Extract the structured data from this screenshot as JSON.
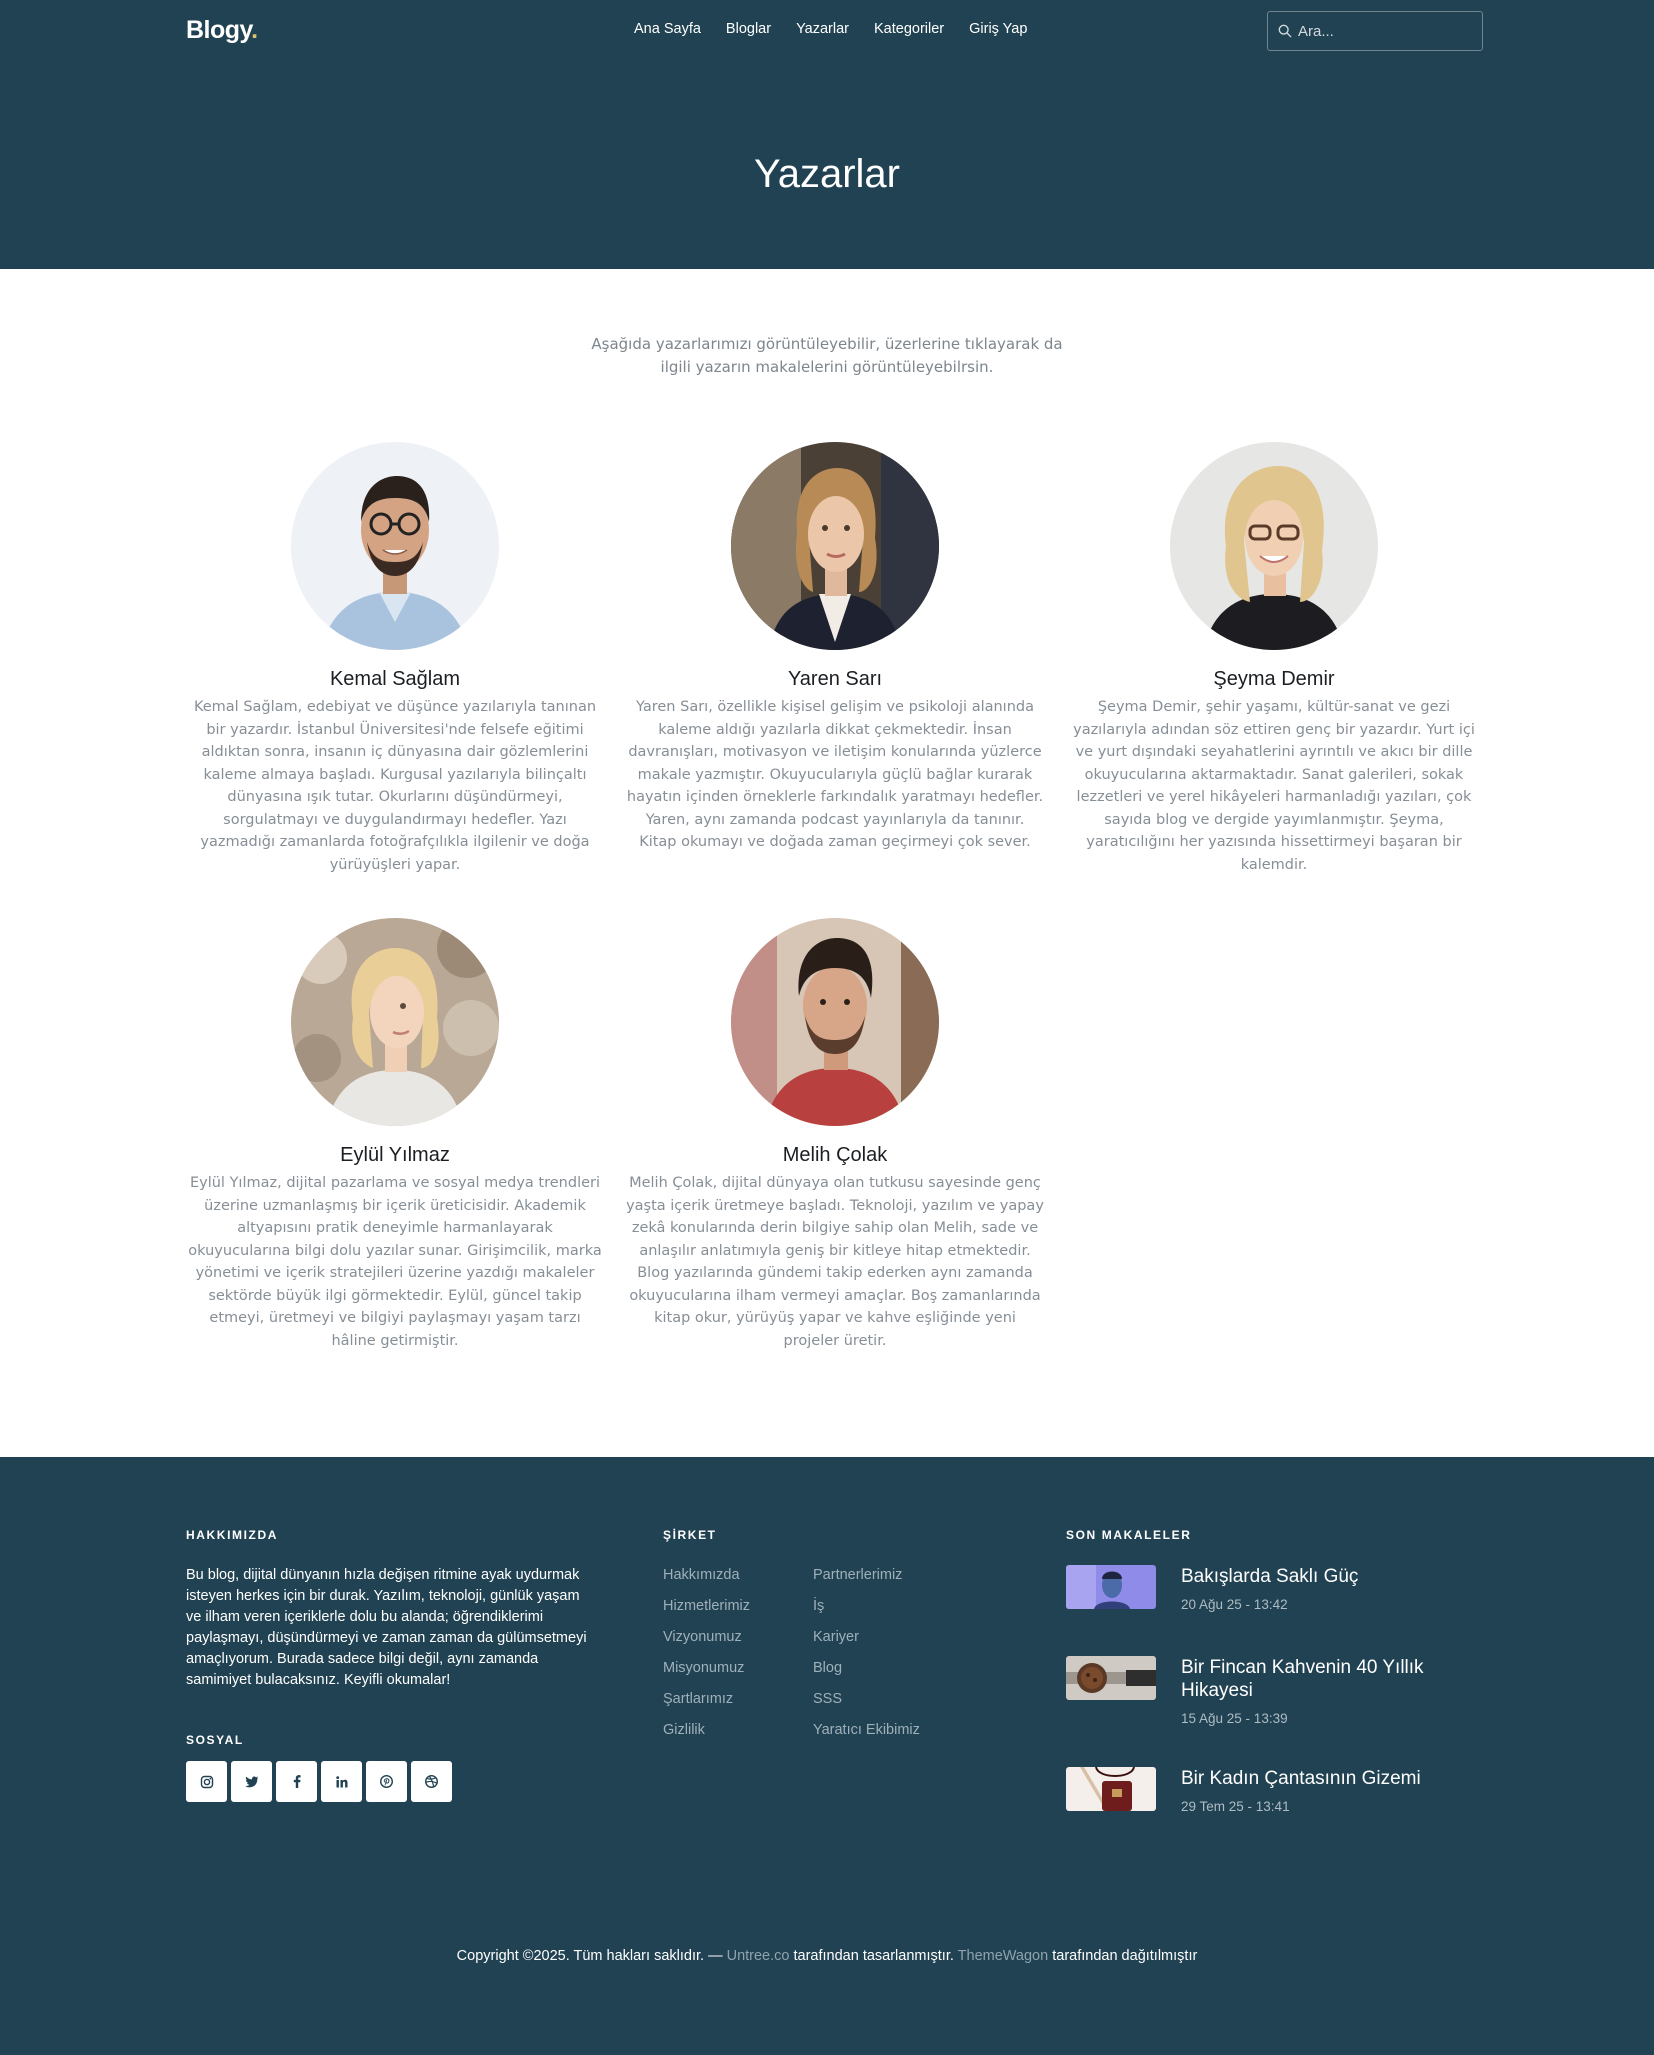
{
  "brand": {
    "name": "Blogy",
    "dot": "."
  },
  "nav": {
    "items": [
      "Ana Sayfa",
      "Bloglar",
      "Yazarlar",
      "Kategoriler",
      "Giriş Yap"
    ]
  },
  "search": {
    "placeholder": "Ara..."
  },
  "hero": {
    "title": "Yazarlar"
  },
  "intro": "Aşağıda yazarlarımızı görüntüleyebilir, üzerlerine tıklayarak da ilgili yazarın makalelerini görüntüleyebilrsin.",
  "authors": [
    {
      "name": "Kemal Sağlam",
      "bio": "Kemal Sağlam, edebiyat ve düşünce yazılarıyla tanınan bir yazardır. İstanbul Üniversitesi'nde felsefe eğitimi aldıktan sonra, insanın iç dünyasına dair gözlemlerini kaleme almaya başladı. Kurgusal yazılarıyla bilinçaltı dünyasına ışık tutar. Okurlarını düşündürmeyi, sorgulatmayı ve duygulandırmayı hedefler. Yazı yazmadığı zamanlarda fotoğrafçılıkla ilgilenir ve doğa yürüyüşleri yapar."
    },
    {
      "name": "Yaren Sarı",
      "bio": "Yaren Sarı, özellikle kişisel gelişim ve psikoloji alanında kaleme aldığı yazılarla dikkat çekmektedir. İnsan davranışları, motivasyon ve iletişim konularında yüzlerce makale yazmıştır. Okuyucularıyla güçlü bağlar kurarak hayatın içinden örneklerle farkındalık yaratmayı hedefler. Yaren, aynı zamanda podcast yayınlarıyla da tanınır. Kitap okumayı ve doğada zaman geçirmeyi çok sever."
    },
    {
      "name": "Şeyma Demir",
      "bio": "Şeyma Demir, şehir yaşamı, kültür-sanat ve gezi yazılarıyla adından söz ettiren genç bir yazardır. Yurt içi ve yurt dışındaki seyahatlerini ayrıntılı ve akıcı bir dille okuyucularına aktarmaktadır. Sanat galerileri, sokak lezzetleri ve yerel hikâyeleri harmanladığı yazıları, çok sayıda blog ve dergide yayımlanmıştır. Şeyma, yaratıcılığını her yazısında hissettirmeyi başaran bir kalemdir."
    },
    {
      "name": "Eylül Yılmaz",
      "bio": "Eylül Yılmaz, dijital pazarlama ve sosyal medya trendleri üzerine uzmanlaşmış bir içerik üreticisidir. Akademik altyapısını pratik deneyimle harmanlayarak okuyucularına bilgi dolu yazılar sunar. Girişimcilik, marka yönetimi ve içerik stratejileri üzerine yazdığı makaleler sektörde büyük ilgi görmektedir. Eylül, güncel takip etmeyi, üretmeyi ve bilgiyi paylaşmayı yaşam tarzı hâline getirmiştir."
    },
    {
      "name": "Melih Çolak",
      "bio": "Melih Çolak, dijital dünyaya olan tutkusu sayesinde genç yaşta içerik üretmeye başladı. Teknoloji, yazılım ve yapay zekâ konularında derin bilgiye sahip olan Melih, sade ve anlaşılır anlatımıyla geniş bir kitleye hitap etmektedir. Blog yazılarında gündemi takip ederken aynı zamanda okuyucularına ilham vermeyi amaçlar. Boş zamanlarında kitap okur, yürüyüş yapar ve kahve eşliğinde yeni projeler üretir."
    }
  ],
  "footer": {
    "about_heading": "HAKKIMIZDA",
    "about_text": "Bu blog, dijital dünyanın hızla değişen ritmine ayak uydurmak isteyen herkes için bir durak. Yazılım, teknoloji, günlük yaşam ve ilham veren içeriklerle dolu bu alanda; öğrendiklerimi paylaşmayı, düşündürmeyi ve zaman zaman da gülümsetmeyi amaçlıyorum. Burada sadece bilgi değil, aynı zamanda samimiyet bulacaksınız. Keyifli okumalar!",
    "social_heading": "SOSYAL",
    "socials": [
      "instagram-icon",
      "twitter-icon",
      "facebook-icon",
      "linkedin-icon",
      "pinterest-icon",
      "dribbble-icon"
    ],
    "company_heading": "ŞİRKET",
    "company_links_1": [
      "Hakkımızda",
      "Hizmetlerimiz",
      "Vizyonumuz",
      "Misyonumuz",
      "Şartlarımız",
      "Gizlilik"
    ],
    "company_links_2": [
      "Partnerlerimiz",
      "İş",
      "Kariyer",
      "Blog",
      "SSS",
      "Yaratıcı Ekibimiz"
    ],
    "recent_heading": "SON MAKALELER",
    "recent_posts": [
      {
        "title": "Bakışlarda Saklı Güç",
        "date": "20 Ağu 25 - 13:42"
      },
      {
        "title": "Bir Fincan Kahvenin 40 Yıllık Hikayesi",
        "date": "15 Ağu 25 - 13:39"
      },
      {
        "title": "Bir Kadın Çantasının Gizemi",
        "date": "29 Tem 25 - 13:41"
      }
    ],
    "copyright": {
      "prefix": "Copyright ©2025. Tüm hakları saklıdır. — ",
      "link1": "Untree.co",
      "mid": " tarafından tasarlanmıştır. ",
      "link2": "ThemeWagon",
      "suffix": " tarafından dağıtılmıştır"
    }
  },
  "colors": {
    "header_bg": "#214252",
    "accent": "#e1c16e"
  }
}
